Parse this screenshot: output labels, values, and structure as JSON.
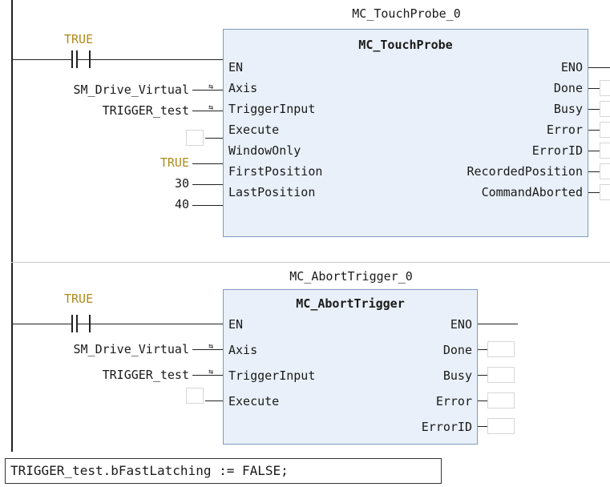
{
  "rung1": {
    "instance_name": "MC_TouchProbe_0",
    "block_name": "MC_TouchProbe",
    "contact_var": "TRUE",
    "inputs": [
      {
        "pin": "EN",
        "value": ""
      },
      {
        "pin": "Axis",
        "value": "SM_Drive_Virtual"
      },
      {
        "pin": "TriggerInput",
        "value": "TRIGGER_test"
      },
      {
        "pin": "Execute",
        "value": ""
      },
      {
        "pin": "WindowOnly",
        "value": "TRUE"
      },
      {
        "pin": "FirstPosition",
        "value": "30"
      },
      {
        "pin": "LastPosition",
        "value": "40"
      }
    ],
    "outputs": [
      "ENO",
      "Done",
      "Busy",
      "Error",
      "ErrorID",
      "RecordedPosition",
      "CommandAborted"
    ]
  },
  "rung2": {
    "instance_name": "MC_AbortTrigger_0",
    "block_name": "MC_AbortTrigger",
    "contact_var": "TRUE",
    "inputs": [
      {
        "pin": "EN",
        "value": ""
      },
      {
        "pin": "Axis",
        "value": "SM_Drive_Virtual"
      },
      {
        "pin": "TriggerInput",
        "value": "TRIGGER_test"
      },
      {
        "pin": "Execute",
        "value": ""
      }
    ],
    "outputs": [
      "ENO",
      "Done",
      "Busy",
      "Error",
      "ErrorID"
    ]
  },
  "st_code": "TRIGGER_test.bFastLatching := FALSE;",
  "colors": {
    "block_fill": "#e9f0f9",
    "block_border": "#7f9bbd",
    "literal": "#b08a1a"
  }
}
